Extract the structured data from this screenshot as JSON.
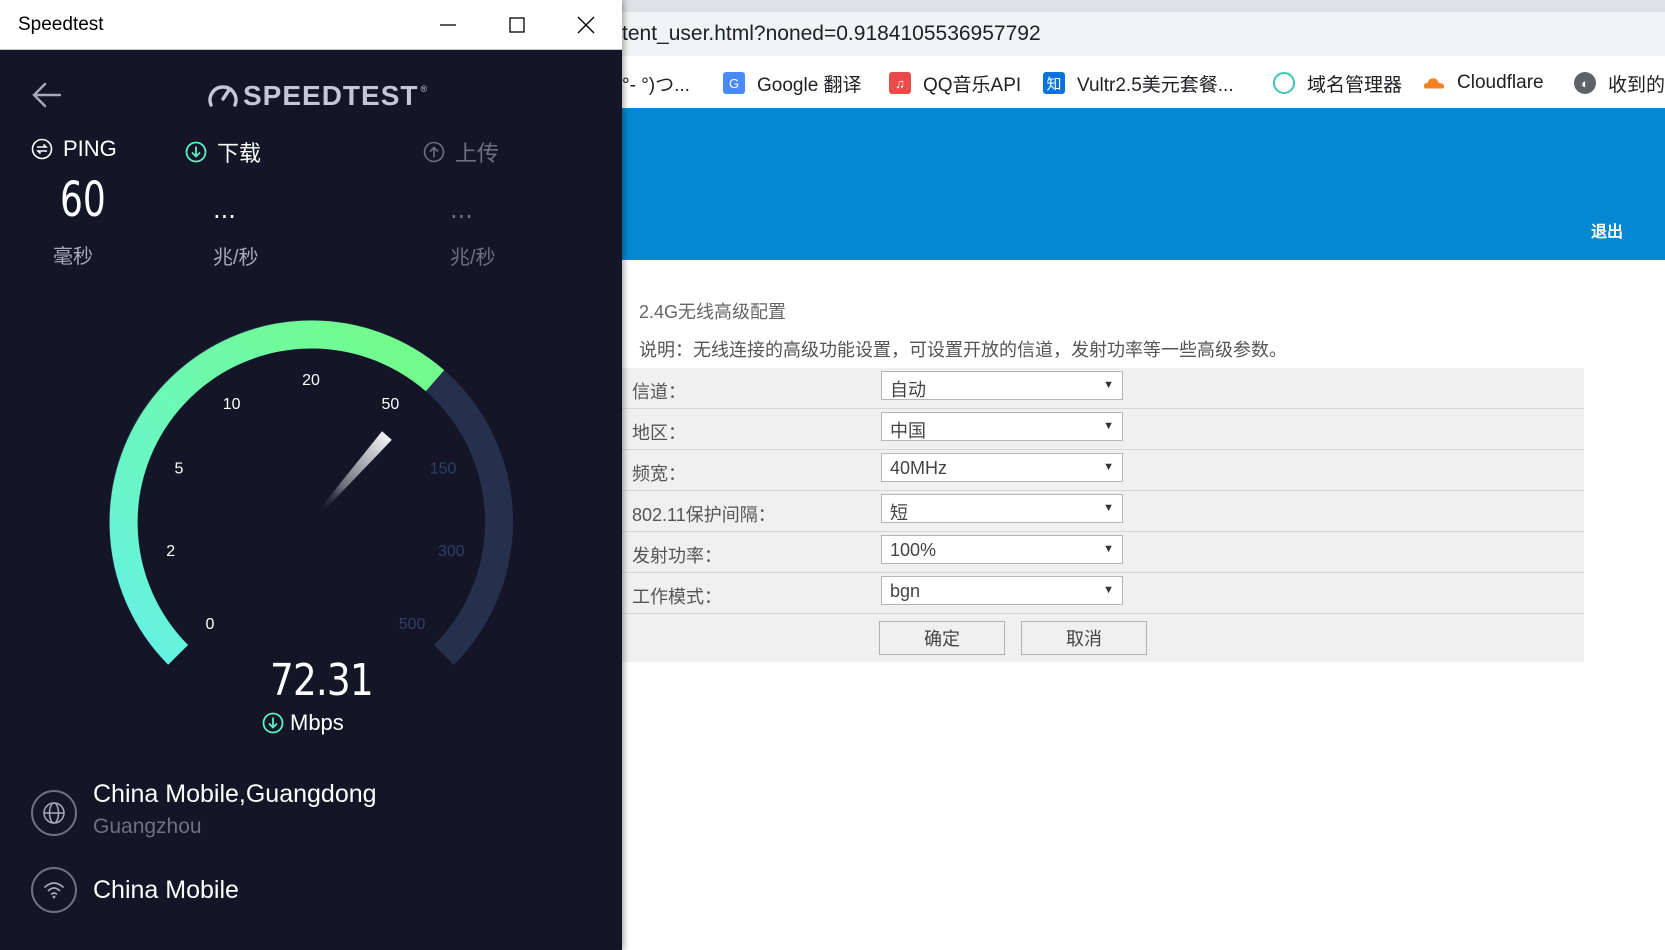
{
  "browser": {
    "url": "tent_user.html?noned=0.9184105536957792",
    "bookmarks": [
      {
        "label": "°- °)つ...",
        "icon": "folder-icon"
      },
      {
        "label": "Google 翻译",
        "icon": "google-translate-icon"
      },
      {
        "label": "QQ音乐API",
        "icon": "qq-music-icon"
      },
      {
        "label": "Vultr2.5美元套餐...",
        "icon": "zhihu-icon"
      },
      {
        "label": "域名管理器",
        "icon": "domain-manager-icon"
      },
      {
        "label": "Cloudflare",
        "icon": "cloudflare-icon"
      },
      {
        "label": "收到的",
        "icon": "globe-icon"
      }
    ],
    "header": {
      "logout": "退出"
    },
    "config": {
      "title": "2.4G无线高级配置",
      "description": "说明：无线连接的高级功能设置，可设置开放的信道，发射功率等一些高级参数。",
      "rows": [
        {
          "label": "信道：",
          "value": "自动"
        },
        {
          "label": "地区：",
          "value": "中国"
        },
        {
          "label": "频宽：",
          "value": "40MHz"
        },
        {
          "label": "802.11保护间隔：",
          "value": "短"
        },
        {
          "label": "发射功率：",
          "value": "100%"
        },
        {
          "label": "工作模式：",
          "value": "bgn"
        }
      ],
      "confirm": "确定",
      "cancel": "取消"
    }
  },
  "speedtest": {
    "window_title": "Speedtest",
    "logo": "SPEEDTEST",
    "logo_tm": "®",
    "ping": {
      "label": "PING",
      "value": "60",
      "unit": "毫秒"
    },
    "download": {
      "label": "下载",
      "value": "...",
      "unit": "兆/秒"
    },
    "upload": {
      "label": "上传",
      "value": "...",
      "unit": "兆/秒"
    },
    "gauge": {
      "ticks": [
        "0",
        "2",
        "5",
        "10",
        "20",
        "50",
        "150",
        "300",
        "500"
      ],
      "needle_value": 72.31,
      "current_speed": "72.31",
      "unit": "Mbps"
    },
    "isp": {
      "name": "China Mobile,Guangdong",
      "city": "Guangzhou"
    },
    "connection": {
      "name": "China Mobile"
    },
    "colors": {
      "accent": "#5ef0c4",
      "background": "#141526",
      "track": "#26304d"
    }
  }
}
